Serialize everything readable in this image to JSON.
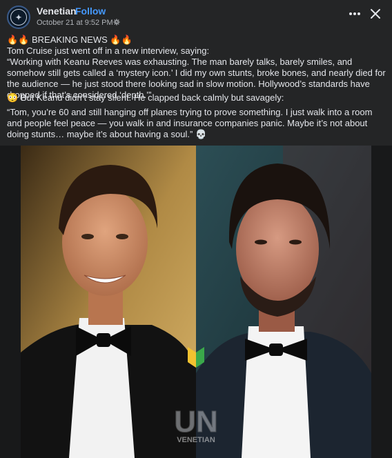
{
  "header": {
    "page_name": "Venetian",
    "separator": "·",
    "follow_label": "Follow",
    "timestamp": "October 21 at 9:52 PM ·",
    "audience_icon": "gear-icon",
    "more_icon": "more-horizontal-icon",
    "close_icon": "close-icon"
  },
  "post": {
    "headline": "BREAKING NEWS",
    "line1": "Tom Cruise just went off in a new interview, saying:",
    "quote1": "“Working with Keanu Reeves was exhausting. The man barely talks, barely smiles, and somehow still gets called a ‘mystery icon.’ I did my own stunts, broke bones, and nearly died for the audience — he just stood there looking sad in slow motion. Hollywood’s standards have dropped if that’s considered ‘depth.’”",
    "line2": "But Keanu didn’t stay silent. He clapped back calmly but savagely:",
    "quote2": "“Tom, you’re 60 and still hanging off planes trying to prove something. I just walk into a room and people feel peace — you walk in and insurance companies panic. Maybe it’s not about doing stunts… maybe it’s about having a soul.”"
  },
  "image": {
    "watermark_letters": "UN",
    "watermark_name": "VENETIAN",
    "colors": {
      "left_bg": "#c9a45c",
      "right_bg": "#1f3a40",
      "accent_green": "#3aa84a",
      "accent_yellow": "#f2c230"
    }
  }
}
